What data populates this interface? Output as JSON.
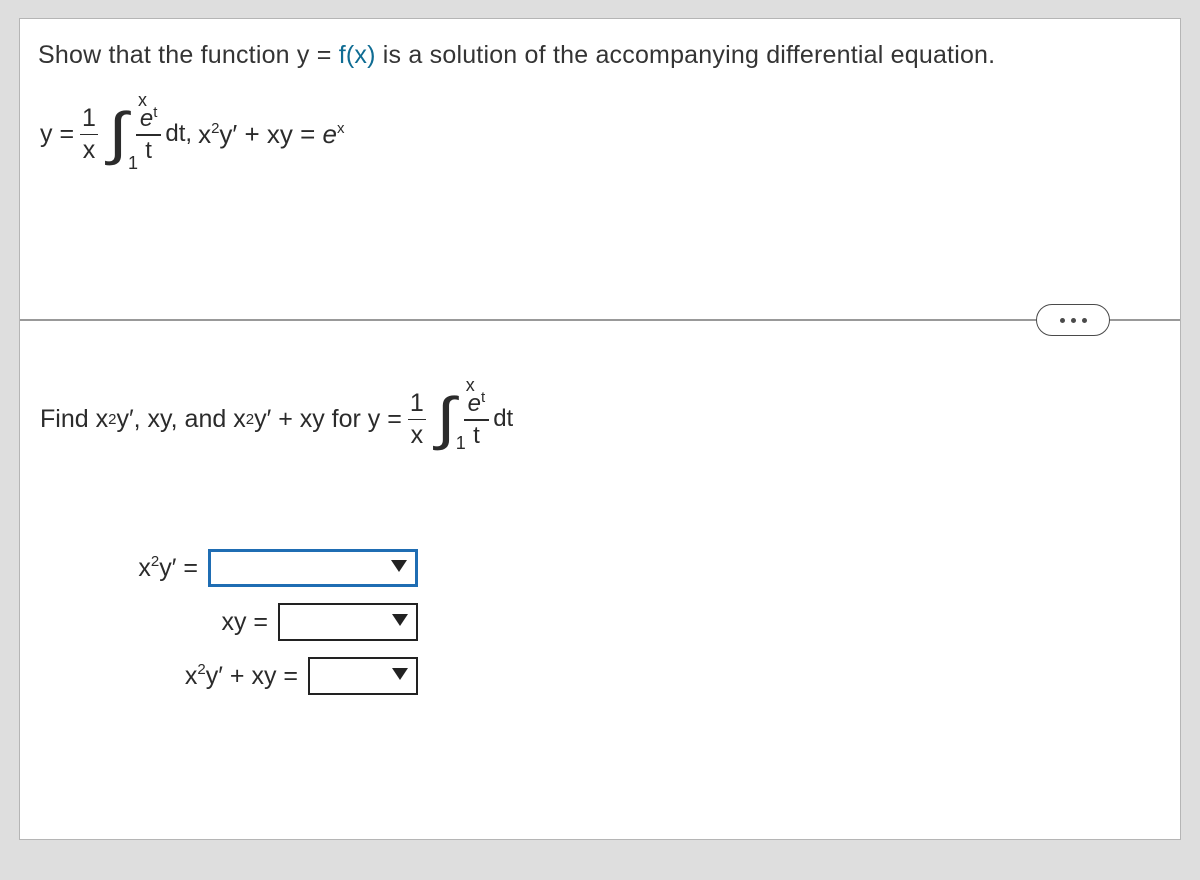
{
  "instruction_pre": "Show that the function y = ",
  "instruction_fx": "f(x)",
  "instruction_post": " is a solution of the accompanying differential equation.",
  "eq": {
    "y_eq": "y =",
    "frac_num": "1",
    "frac_den": "x",
    "int_upper": "x",
    "int_lower": "1",
    "int_num_e": "e",
    "int_num_sup": "t",
    "int_den": "t",
    "dt": "dt,",
    "after_pre": " x",
    "after_sup1": "2",
    "after_mid": "y′ + xy = ",
    "after_e": "e",
    "after_supx": "x"
  },
  "prompt2": {
    "pre": "Find x",
    "sup1": "2",
    "mid1": "y′, xy, and x",
    "sup2": "2",
    "mid2": "y′ + xy for y = ",
    "dt": "dt"
  },
  "answers": {
    "r1_pre": "x",
    "r1_sup": "2",
    "r1_post": "y′ =",
    "r2": "xy =",
    "r3_pre": "x",
    "r3_sup": "2",
    "r3_post": "y′ + xy ="
  }
}
